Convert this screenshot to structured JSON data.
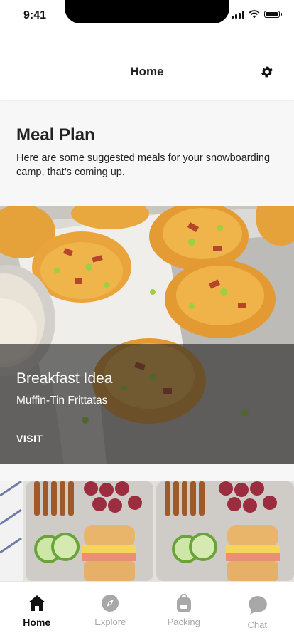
{
  "status_bar": {
    "time": "9:41"
  },
  "header": {
    "title": "Home",
    "settings_icon": "gear-icon"
  },
  "intro": {
    "title": "Meal Plan",
    "description": "Here are some suggested meals for your snowboarding camp, that’s coming up."
  },
  "cards": [
    {
      "category": "Breakfast Idea",
      "title": "Muffin-Tin Frittatas",
      "action": "VISIT"
    }
  ],
  "tab_bar": {
    "items": [
      {
        "label": "Home",
        "icon": "home-icon",
        "active": true
      },
      {
        "label": "Explore",
        "icon": "compass-icon",
        "active": false
      },
      {
        "label": "Packing",
        "icon": "backpack-icon",
        "active": false
      },
      {
        "label": "Chat",
        "icon": "chat-icon",
        "active": false
      }
    ]
  },
  "colors": {
    "active_tab": "#111111",
    "inactive_tab": "#a8a8a8",
    "overlay": "#232323"
  }
}
